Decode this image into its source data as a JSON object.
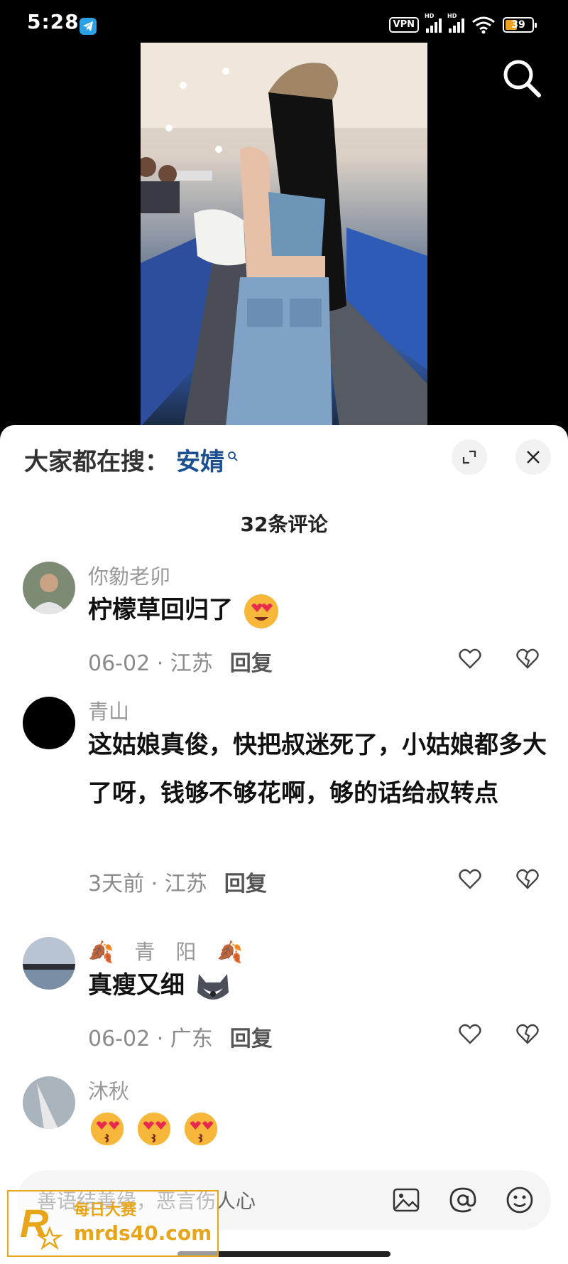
{
  "status_bar": {
    "time": "5:28",
    "vpn": "VPN",
    "signal_hd": "HD",
    "battery": "39"
  },
  "video": {
    "search_icon": "search-icon"
  },
  "panel": {
    "search_label": "大家都在搜：",
    "search_keyword": "安婧",
    "comment_count": "32条评论"
  },
  "comments": [
    {
      "name": "你勨老卯",
      "text": "柠檬草回归了",
      "date": "06-02",
      "location": "江苏",
      "reply": "回复"
    },
    {
      "name": "青山",
      "text": "这姑娘真俊，快把叔迷死了，小姑娘都多大了呀，钱够不够花啊，够的话给叔转点",
      "date": "3天前",
      "location": "江苏",
      "reply": "回复"
    },
    {
      "name": "青　阳",
      "text": "真瘦又细",
      "date": "06-02",
      "location": "广东",
      "reply": "回复"
    },
    {
      "name": "沐秋",
      "text": ""
    }
  ],
  "input": {
    "placeholder": "善语结善缘，恶言伤人心",
    "icons": [
      "image-icon",
      "at-icon",
      "emoji-icon"
    ]
  },
  "watermark": {
    "title": "每日大赛",
    "url": "mrds40.com"
  },
  "colors": {
    "accent": "#1b4f8f",
    "battery": "#f0a020",
    "watermark": "#e8a51a"
  }
}
